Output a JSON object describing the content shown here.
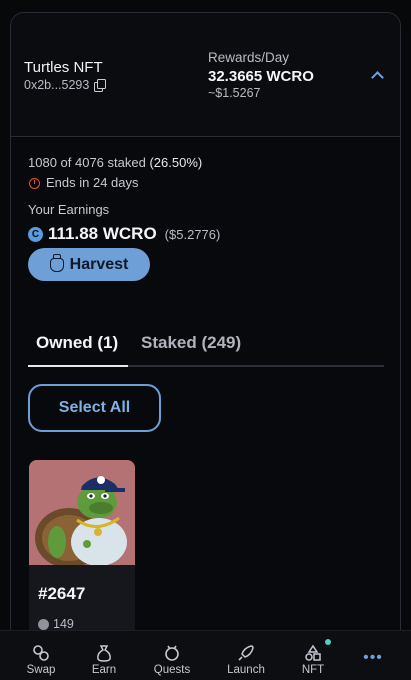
{
  "pool": {
    "name": "Turtles NFT",
    "address": "0x2b...5293",
    "rewards_label": "Rewards/Day",
    "rewards_value": "32.3665 WCRO",
    "rewards_usd": "~$1.5267"
  },
  "stats": {
    "staked_text": "1080 of 4076 staked",
    "staked_pct": "(26.50%)",
    "ends_text": "Ends in 24 days",
    "earnings_label": "Your Earnings",
    "earnings_amount": "111.88 WCRO",
    "earnings_usd": "($5.2776)",
    "earnings_icon": "cro-token-icon"
  },
  "harvest": {
    "label": "Harvest"
  },
  "tabs": [
    {
      "label": "Owned (1)",
      "active": true
    },
    {
      "label": "Staked (249)",
      "active": false
    }
  ],
  "select_all": {
    "label": "Select All"
  },
  "nfts": [
    {
      "id": "#2647",
      "value": "149"
    }
  ],
  "nav": [
    {
      "label": "Swap",
      "icon": "swap-icon"
    },
    {
      "label": "Earn",
      "icon": "money-bag-icon"
    },
    {
      "label": "Quests",
      "icon": "quests-icon"
    },
    {
      "label": "Launch",
      "icon": "rocket-icon"
    },
    {
      "label": "NFT",
      "icon": "shapes-icon"
    },
    {
      "label": "",
      "icon": "more-icon"
    }
  ],
  "colors": {
    "accent": "#6e9fd6",
    "timer": "#e2543d",
    "nft_background": "#b47274",
    "notification_dot": "#4fd1c0"
  }
}
